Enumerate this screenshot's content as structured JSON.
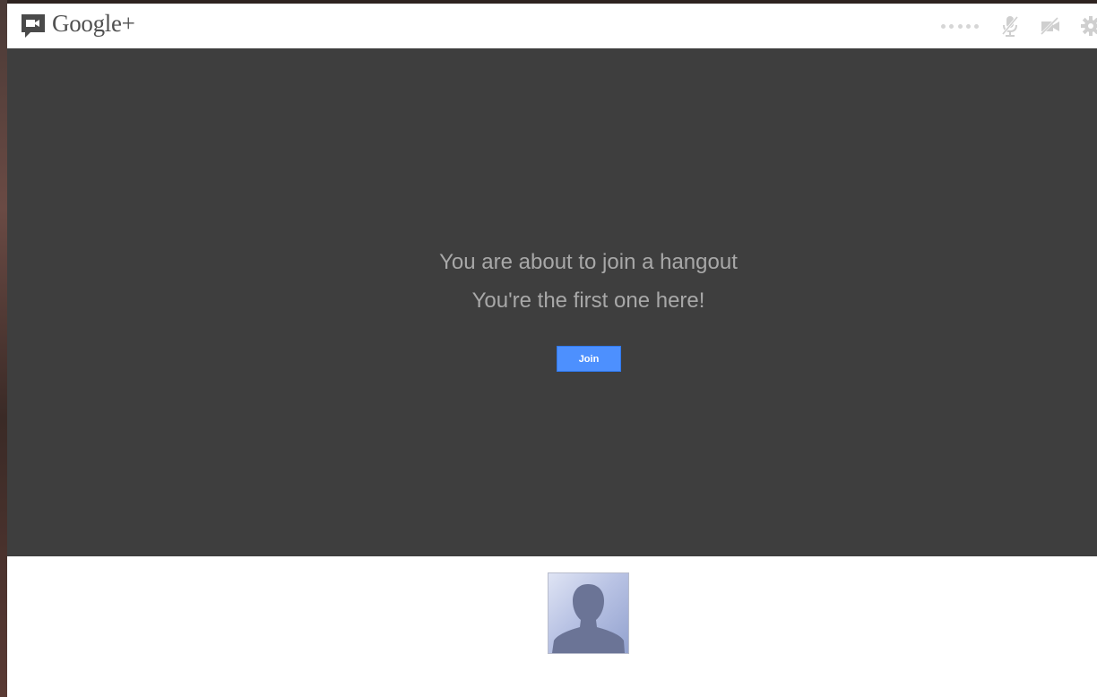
{
  "header": {
    "brand": "Google+",
    "icons": [
      "hangouts-logo-icon",
      "signal-dots-icon",
      "mic-mute-icon",
      "camera-off-icon",
      "gear-icon"
    ]
  },
  "stage": {
    "line1": "You are about to join a hangout",
    "line2": "You're the first one here!",
    "join_label": "Join"
  },
  "colors": {
    "stage_bg": "#3e3e3e",
    "join_button": "#4d90fe",
    "message_text": "#a8a8a8",
    "brand_text": "#505050"
  }
}
